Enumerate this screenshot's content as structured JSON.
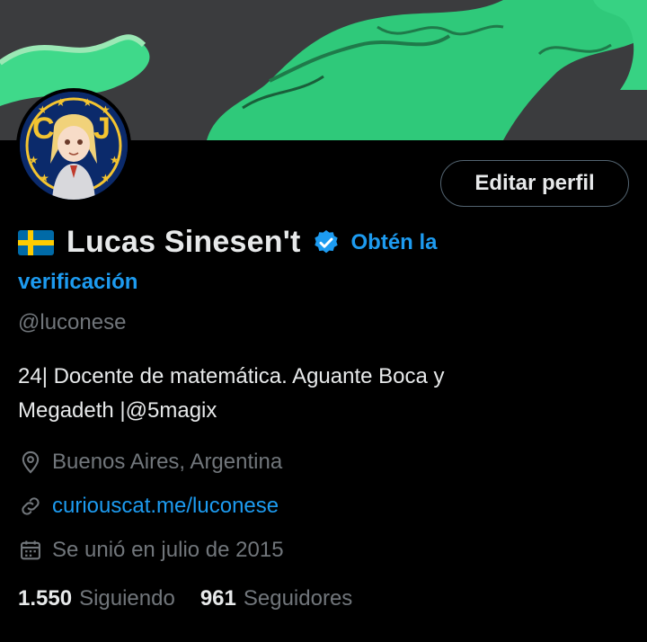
{
  "profile": {
    "display_name": "Lucas Sinesen't",
    "get_verified_part1": "Obtén la",
    "get_verified_part2": "verificación",
    "handle": "@luconese",
    "bio_line1": "24| Docente de matemática. Aguante Boca y",
    "bio_line2": "Megadeth |@5magix",
    "location": "Buenos Aires, Argentina",
    "website": "curiouscat.me/luconese",
    "joined": "Se unió en julio de 2015",
    "following_count": "1.550",
    "following_label": "Siguiendo",
    "followers_count": "961",
    "followers_label": "Seguidores"
  },
  "actions": {
    "edit_profile_label": "Editar perfil"
  },
  "icons": {
    "flag": "sweden-flag-icon",
    "verified": "verified-badge-icon",
    "location": "location-pin-icon",
    "link": "link-icon",
    "calendar": "calendar-icon"
  },
  "colors": {
    "accent": "#1d9bf0",
    "muted": "#71767b",
    "text": "#e7e9ea",
    "background": "#000000"
  }
}
